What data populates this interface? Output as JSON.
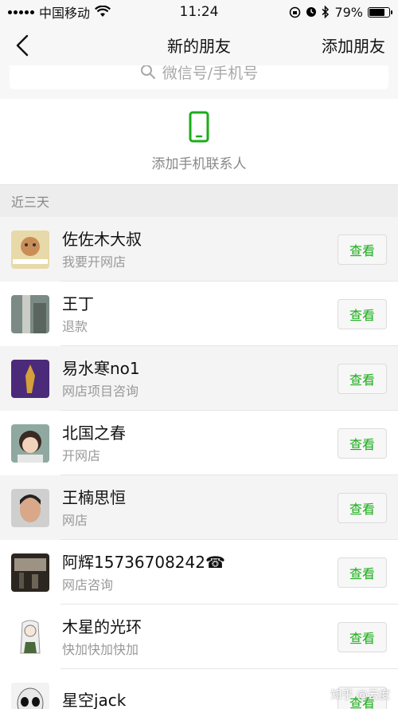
{
  "status_bar": {
    "carrier": "中国移动",
    "time": "11:24",
    "battery_percent": "79%",
    "battery_level": 0.79,
    "icons": [
      "signal-icon",
      "wifi-icon",
      "lock-rotation-icon",
      "alarm-icon",
      "bluetooth-icon",
      "battery-icon"
    ]
  },
  "nav": {
    "title": "新的朋友",
    "right_action": "添加朋友"
  },
  "search": {
    "placeholder": "微信号/手机号"
  },
  "phone_contacts": {
    "label": "添加手机联系人",
    "icon_color": "#1aad19"
  },
  "section": {
    "label": "近三天"
  },
  "requests": [
    {
      "name": "佐佐木大叔",
      "message": "我要开网店",
      "action": "查看"
    },
    {
      "name": "王丁",
      "message": "退款",
      "action": "查看"
    },
    {
      "name": "易水寒no1",
      "message": "网店项目咨询",
      "action": "查看"
    },
    {
      "name": "北国之春",
      "message": "开网店",
      "action": "查看"
    },
    {
      "name": "王楠思恒",
      "message": "网店",
      "action": "查看"
    },
    {
      "name": "阿辉15736708242☎",
      "message": "网店咨询",
      "action": "查看"
    },
    {
      "name": "木星的光环",
      "message": "快加快加快加",
      "action": "查看"
    },
    {
      "name": "星空jack",
      "message": "",
      "action": "查看"
    }
  ],
  "watermark": "知乎 @云度",
  "colors": {
    "accent": "#1aad19",
    "background": "#ededed"
  }
}
